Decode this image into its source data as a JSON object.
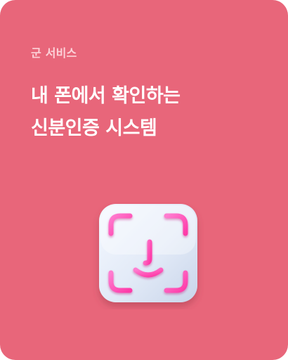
{
  "card": {
    "category": "군 서비스",
    "title_lines": [
      "내 폰에서 확인하는",
      "신분인증 시스템"
    ],
    "icon": "face-id-icon"
  },
  "colors": {
    "card_background": "#e8667a",
    "category_text": "#fcd1d8",
    "title_text": "#ffffff",
    "icon_tile": "#e4ecf8",
    "icon_glyph": "#ff4fb6"
  }
}
